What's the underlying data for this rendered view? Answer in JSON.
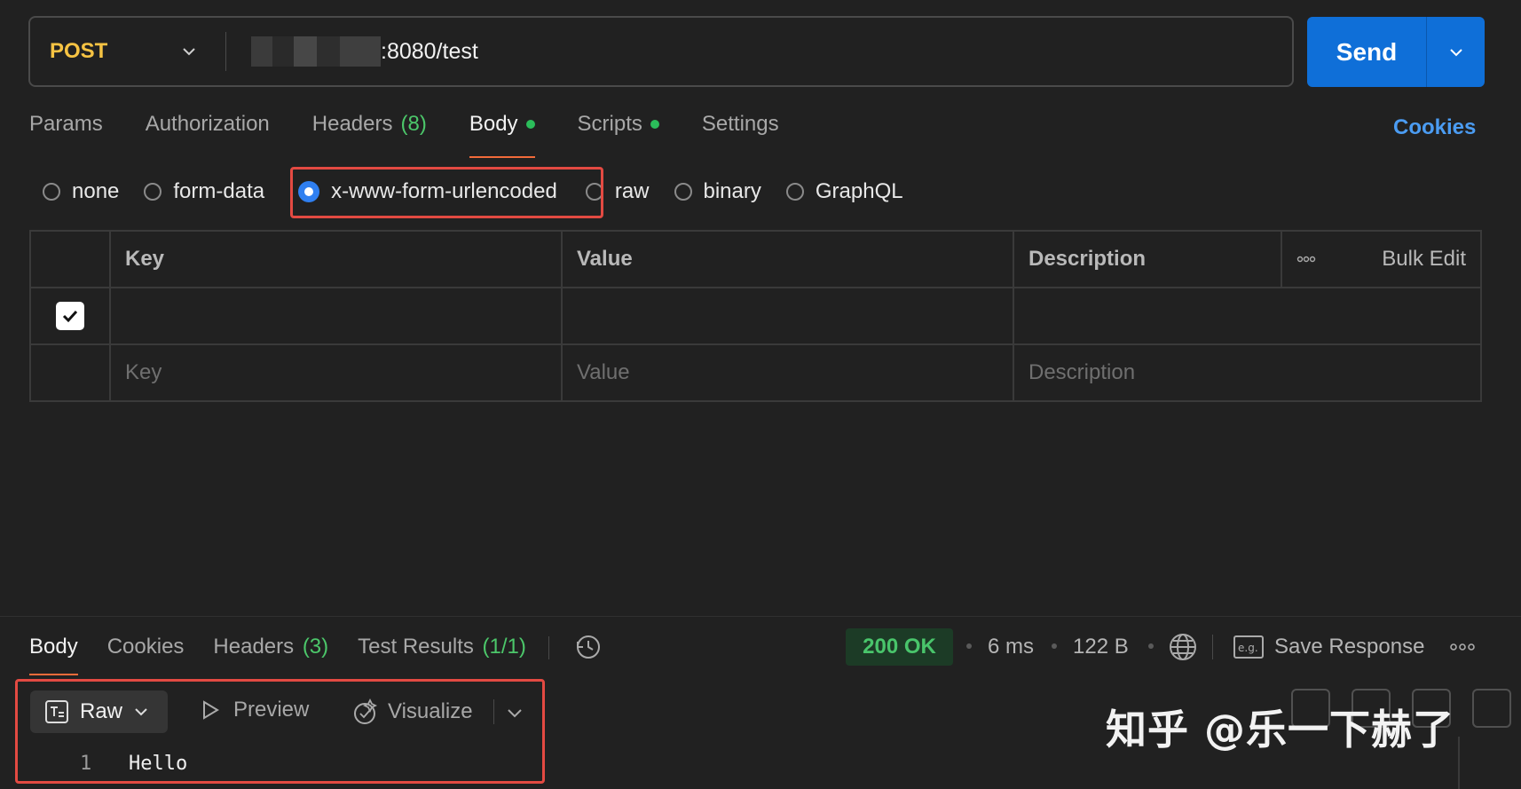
{
  "request": {
    "method": "POST",
    "url_suffix": ":8080/test",
    "send_label": "Send"
  },
  "request_tabs": {
    "params": "Params",
    "authorization": "Authorization",
    "headers": "Headers",
    "headers_count": "(8)",
    "body": "Body",
    "scripts": "Scripts",
    "settings": "Settings",
    "cookies": "Cookies"
  },
  "body_types": {
    "none": "none",
    "form_data": "form-data",
    "urlencoded": "x-www-form-urlencoded",
    "raw": "raw",
    "binary": "binary",
    "graphql": "GraphQL",
    "selected": "x-www-form-urlencoded"
  },
  "table": {
    "headers": [
      "Key",
      "Value",
      "Description"
    ],
    "bulk_edit": "Bulk Edit",
    "placeholders": {
      "key": "Key",
      "value": "Value",
      "description": "Description"
    }
  },
  "response": {
    "tabs": {
      "body": "Body",
      "cookies": "Cookies",
      "headers": "Headers",
      "headers_count": "(3)",
      "test_results": "Test Results",
      "test_count": "(1/1)"
    },
    "status": "200 OK",
    "time": "6 ms",
    "size": "122 B",
    "save_response": "Save Response",
    "view_mode": "Raw",
    "preview": "Preview",
    "visualize": "Visualize",
    "lines": [
      {
        "number": "1",
        "text": "Hello"
      }
    ]
  },
  "watermark": "知乎 @乐一下赫了",
  "colors": {
    "method": "#f6c343",
    "send": "#0f6fd8",
    "accent_underline": "#f26b3a",
    "count_green": "#4cc76a",
    "status_green": "#49c56b",
    "link_blue": "#4b9cf2",
    "highlight_red": "#e34a42",
    "radio_selected": "#2f7ff0"
  }
}
